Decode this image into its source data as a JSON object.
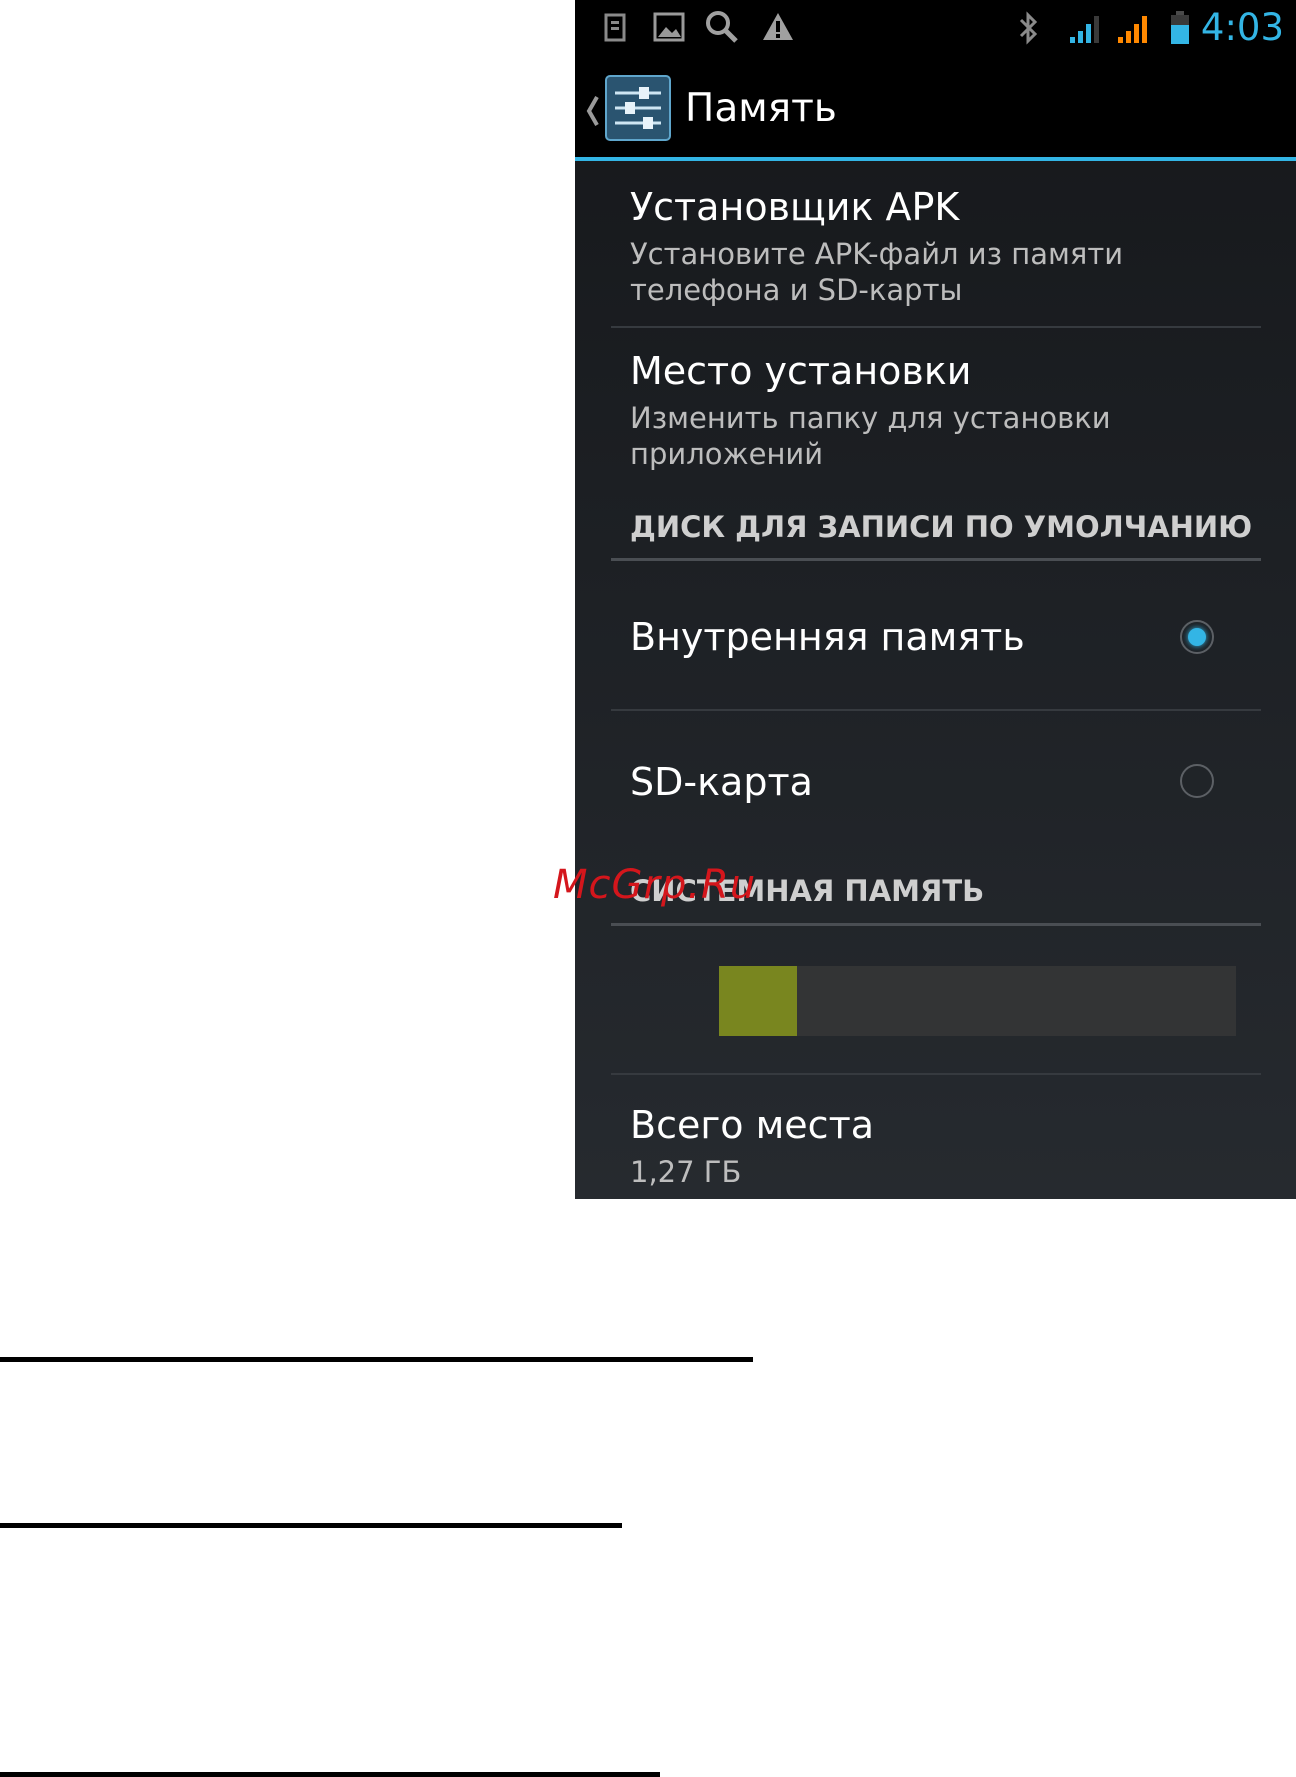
{
  "status_bar": {
    "time": "4:03",
    "left_icons": [
      "sim-card-icon",
      "image-icon",
      "search-icon",
      "warning-icon"
    ],
    "right_icons": [
      "bluetooth-icon",
      "signal-icon",
      "signal-icon",
      "battery-icon"
    ],
    "accent": "#33b5e5",
    "signal_secondary": "#ff8800"
  },
  "action_bar": {
    "title": "Память"
  },
  "items": [
    {
      "title": "Установщик APK",
      "summary": "Установите APK-файл из памяти телефона и SD-карты"
    },
    {
      "title": "Место установки",
      "summary": "Изменить папку для установки приложений"
    }
  ],
  "default_disk": {
    "header": "ДИСК ДЛЯ ЗАПИСИ ПО УМОЛЧАНИЮ",
    "options": [
      {
        "label": "Внутренняя память",
        "selected": true
      },
      {
        "label": "SD-карта",
        "selected": false
      }
    ]
  },
  "system_memory": {
    "header": "СИСТЕМНАЯ ПАМЯТЬ",
    "used_fraction": 0.15,
    "used_color": "#79861f",
    "total_label": "Всего места",
    "total_value": "1,27 ГБ"
  },
  "watermark": "McGrp.Ru"
}
